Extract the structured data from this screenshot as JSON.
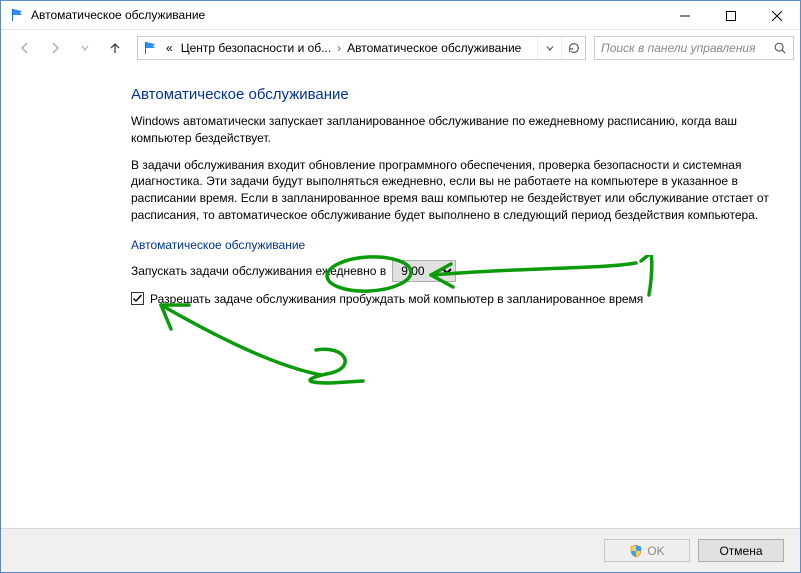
{
  "window": {
    "title": "Автоматическое обслуживание"
  },
  "breadcrumb": {
    "prefix": "«",
    "item1": "Центр безопасности и об...",
    "item2": "Автоматическое обслуживание"
  },
  "search": {
    "placeholder": "Поиск в панели управления"
  },
  "main": {
    "heading": "Автоматическое обслуживание",
    "p1": "Windows автоматически запускает запланированное обслуживание по ежедневному расписанию, когда ваш компьютер бездействует.",
    "p2": "В задачи обслуживания входит обновление программного обеспечения, проверка безопасности и системная диагностика. Эти задачи будут выполняться ежедневно, если вы не работаете на компьютере в указанное в расписании время. Если в запланированное время ваш компьютер не бездействует или обслуживание отстает от расписания, то автоматическое обслуживание будет выполнено в следующий период бездействия компьютера.",
    "section_label": "Автоматическое обслуживание",
    "schedule_label": "Запускать задачи обслуживания ежедневно в",
    "time_value": "9:00",
    "checkbox_label": "Разрешать задаче обслуживания пробуждать мой компьютер в запланированное время"
  },
  "annotations": {
    "mark1": "1",
    "mark2": "2"
  },
  "footer": {
    "ok": "OK",
    "cancel": "Отмена"
  }
}
